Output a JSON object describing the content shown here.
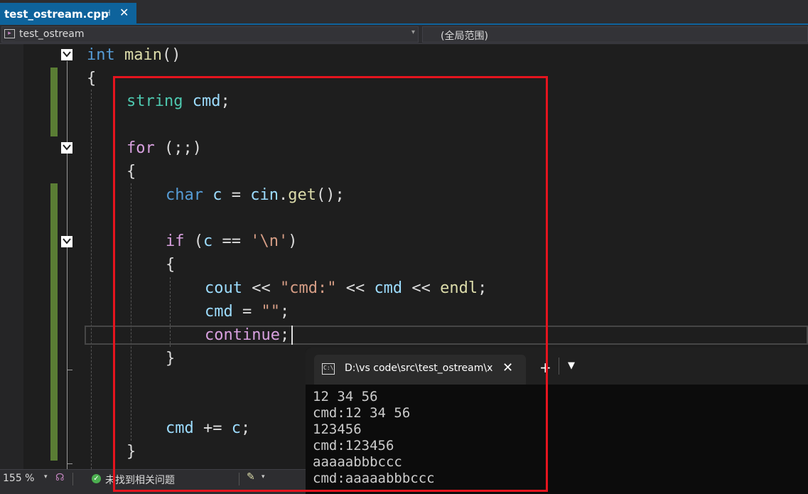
{
  "tab": {
    "filename": "test_ostream.cpp",
    "pin": "⊣",
    "close": "✕"
  },
  "navbar": {
    "project": "test_ostream",
    "scope": "(全局范围)",
    "icon": "project-icon"
  },
  "code": {
    "l1": {
      "a": "int",
      "b": " ",
      "c": "main",
      "d": "()"
    },
    "l2": {
      "a": "{"
    },
    "l3": {
      "a": "string",
      "b": " ",
      "c": "cmd",
      "d": ";"
    },
    "l5": {
      "a": "for",
      "b": " (;;)"
    },
    "l6": {
      "a": "{"
    },
    "l7": {
      "a": "char",
      "b": " ",
      "c": "c",
      "d": " = ",
      "e": "cin",
      "f": ".",
      "g": "get",
      "h": "();"
    },
    "l9": {
      "a": "if",
      "b": " (",
      "c": "c",
      "d": " == ",
      "e": "'\\n'",
      "f": ")"
    },
    "l10": {
      "a": "{"
    },
    "l11": {
      "a": "cout",
      "b": " << ",
      "c": "\"cmd:\"",
      "d": " << ",
      "e": "cmd",
      "f": " << ",
      "g": "endl",
      "h": ";"
    },
    "l12": {
      "a": "cmd",
      "b": " = ",
      "c": "\"\"",
      "d": ";"
    },
    "l13": {
      "a": "continue",
      "b": ";"
    },
    "l14": {
      "a": "}"
    },
    "l17": {
      "a": "cmd",
      "b": " += ",
      "c": "c",
      "d": ";"
    },
    "l18": {
      "a": "}"
    }
  },
  "terminal": {
    "title": "D:\\vs code\\src\\test_ostream\\x",
    "icon_text": "C:\\",
    "close": "✕",
    "plus": "+",
    "dropdown": "⌄",
    "lines": [
      "12 34 56",
      "cmd:12 34 56",
      "123456",
      "cmd:123456",
      "aaaaabbbccc",
      "cmd:aaaaabbbccc"
    ]
  },
  "status": {
    "zoom": "155 %",
    "zoom_chevron": "▾",
    "issues": "未找到相关问题",
    "ok_icon": "✓",
    "brush_chevron": "▾"
  },
  "colors": {
    "keyword": "#569cd6",
    "control": "#d8a0df",
    "type": "#4ec9b0",
    "function": "#dcdcaa",
    "variable": "#9cdcfe",
    "string": "#d69d85",
    "highlight_box": "#e5141e",
    "tab_accent": "#0e639c"
  }
}
